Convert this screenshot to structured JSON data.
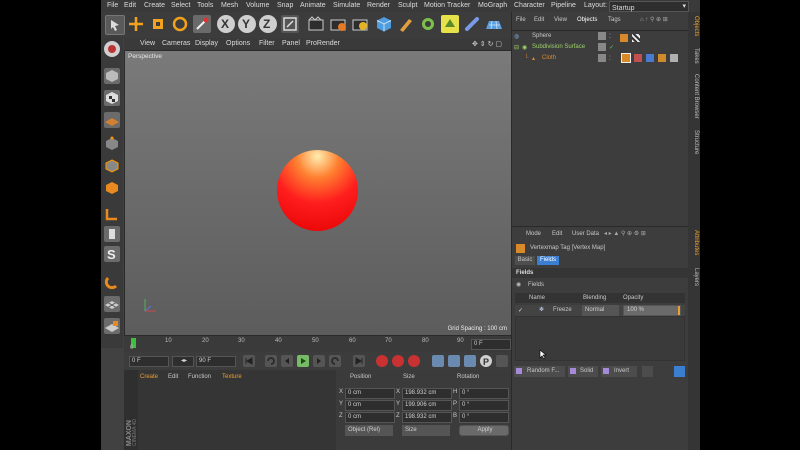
{
  "menubar": {
    "items": [
      "File",
      "Edit",
      "Create",
      "Select",
      "Tools",
      "Mesh",
      "Volume",
      "Snap",
      "Animate",
      "Simulate",
      "Render",
      "Sculpt",
      "Motion Tracker",
      "MoGraph",
      "Character",
      "Pipeline"
    ],
    "layout_label": "Layout:",
    "layout_value": "Startup"
  },
  "toolbar": {
    "axis_x": "X",
    "axis_y": "Y",
    "axis_z": "Z",
    "icons": [
      "undo-icon",
      "move-icon",
      "scale-icon",
      "rotate-icon",
      "recent-tools-icon",
      "axis-x-icon",
      "axis-y-icon",
      "axis-z-icon",
      "coord-system-icon",
      "render-view-icon",
      "render-pv-icon",
      "render-settings-icon",
      "cube-icon",
      "pen-icon",
      "subdivision-icon",
      "extrude-icon",
      "deformer-icon",
      "environment-icon",
      "camera-icon",
      "light-icon"
    ]
  },
  "viewport": {
    "menu": [
      "View",
      "Cameras",
      "Display",
      "Options",
      "Filter",
      "Panel",
      "ProRender"
    ],
    "label": "Perspective",
    "grid_spacing": "Grid Spacing : 100 cm"
  },
  "timeline": {
    "ticks": [
      "0",
      "10",
      "20",
      "30",
      "40",
      "50",
      "60",
      "70",
      "80",
      "90"
    ],
    "frame_end": "0 F"
  },
  "transport": {
    "start": "0 F",
    "end": "90 F"
  },
  "material_panel": {
    "menu": [
      "Create",
      "Edit",
      "Function",
      "Texture"
    ],
    "brand1": "MAXON",
    "brand2": "CINEMA 4D"
  },
  "coord_panel": {
    "headers": [
      "Position",
      "Size",
      "Rotation"
    ],
    "rows": [
      {
        "axis": "X",
        "pos": "0 cm",
        "size_axis": "X",
        "size": "198.932 cm",
        "rot_axis": "H",
        "rot": "0 °"
      },
      {
        "axis": "Y",
        "pos": "0 cm",
        "size_axis": "Y",
        "size": "199.906 cm",
        "rot_axis": "P",
        "rot": "0 °"
      },
      {
        "axis": "Z",
        "pos": "0 cm",
        "size_axis": "Z",
        "size": "198.932 cm",
        "rot_axis": "B",
        "rot": "0 °"
      }
    ],
    "mode": "Object (Rel)",
    "size_mode": "Size",
    "apply": "Apply"
  },
  "object_manager": {
    "menu": [
      "File",
      "Edit",
      "View",
      "Objects",
      "Tags"
    ],
    "objects": [
      {
        "name": "Sphere",
        "color": "#c8c8c8"
      },
      {
        "name": "Subdivision Surface",
        "color": "#9ed16a"
      },
      {
        "name": "Cloth",
        "color": "#e08a2a"
      }
    ]
  },
  "attribute_manager": {
    "menu": [
      "Mode",
      "Edit",
      "User Data"
    ],
    "title": "Vertexmap Tag [Vertex Map]",
    "tabs": [
      "Basic",
      "Fields"
    ],
    "active_tab": "Fields",
    "section": "Fields",
    "group": "Fields",
    "columns": [
      "Name",
      "Blending",
      "Opacity"
    ],
    "layer": {
      "name": "Freeze",
      "blending": "Normal",
      "opacity": "100 %",
      "opacity_fraction": 1.0
    }
  },
  "bottom_tags": {
    "items": [
      "Random F...",
      "Solid",
      "Invert"
    ]
  },
  "right_dock": {
    "tabs": [
      "Objects",
      "Takes",
      "Content Browser",
      "Structure",
      "Attributes",
      "Layers"
    ]
  },
  "colors": {
    "accent": "#f0a000",
    "selection_blue": "#3b7fd0",
    "sphere_red": "#ff1a1a",
    "sphere_highlight": "#ffe9a0"
  }
}
